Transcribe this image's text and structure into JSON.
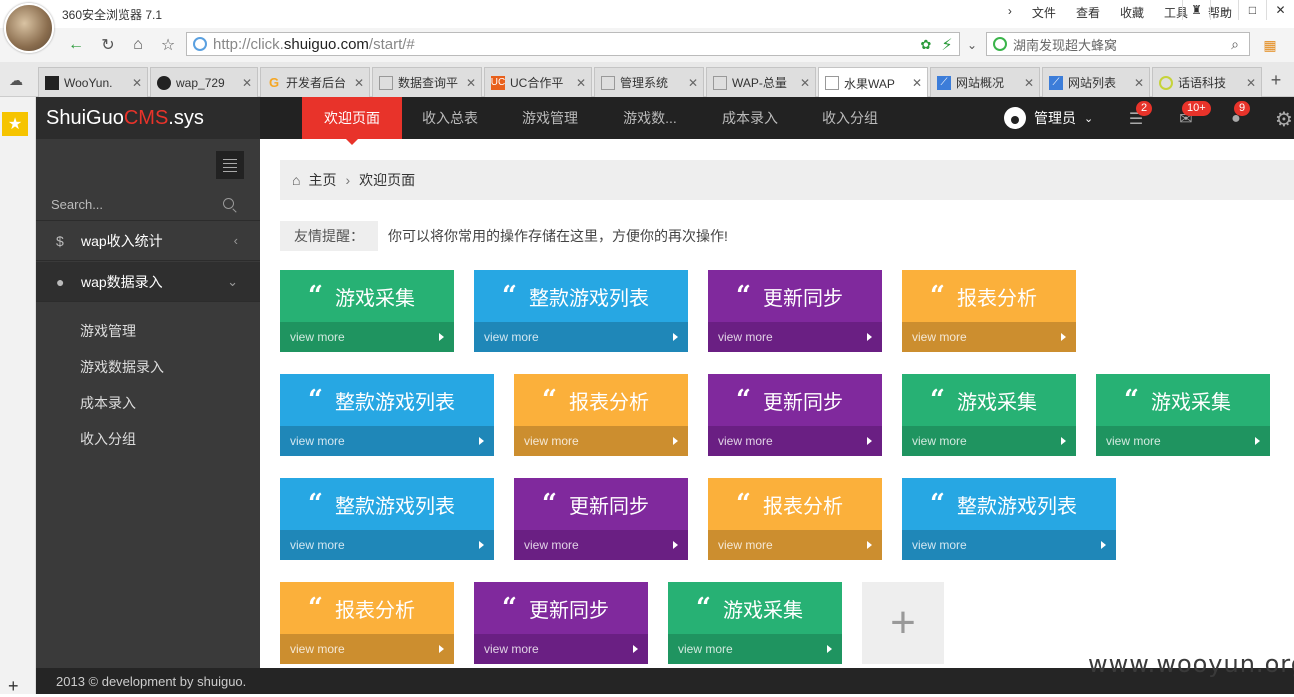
{
  "browser": {
    "title": "360安全浏览器 7.1",
    "menu": [
      "文件",
      "查看",
      "收藏",
      "工具",
      "帮助"
    ],
    "url_prefix": "http://click.",
    "url_domain": "shuiguo.com",
    "url_path": "/start/#",
    "search": "湖南发现超大蜂窝",
    "tabs": [
      {
        "label": "WooYun.",
        "color": "#222"
      },
      {
        "label": "wap_729",
        "color": "#222"
      },
      {
        "label": "开发者后台",
        "color": "#f5a623"
      },
      {
        "label": "数据查询平",
        "color": "#999"
      },
      {
        "label": "UC合作平",
        "color": "#e8601c"
      },
      {
        "label": "管理系统",
        "color": "#999"
      },
      {
        "label": "WAP-总量",
        "color": "#999"
      },
      {
        "label": "水果WAP",
        "color": "#999"
      },
      {
        "label": "网站概况",
        "color": "#3c7dd9"
      },
      {
        "label": "网站列表",
        "color": "#3c7dd9"
      },
      {
        "label": "话语科技",
        "color": "#c6d33a"
      }
    ]
  },
  "brand": {
    "a": "ShuiGuo",
    "b": "CMS",
    ".sys": ".sys",
    "c": ".sys"
  },
  "nav": [
    "欢迎页面",
    "收入总表",
    "游戏管理",
    "游戏数...",
    "成本录入",
    "收入分组"
  ],
  "header": {
    "admin": "管理员",
    "badge1": "2",
    "badge2": "10+",
    "badge3": "9"
  },
  "sidebar": {
    "search": "Search...",
    "m1": "wap收入统计",
    "m2": "wap数据录入",
    "subs": [
      "游戏管理",
      "游戏数据录入",
      "成本录入",
      "收入分组"
    ]
  },
  "breadcrumb": {
    "home": "主页",
    "current": "欢迎页面"
  },
  "tip": {
    "label": "友情提醒：",
    "text": "你可以将你常用的操作存储在这里，方便你的再次操作!"
  },
  "more": "view more",
  "cards": [
    "游戏采集",
    "整款游戏列表",
    "更新同步",
    "报表分析",
    "整款游戏列表",
    "报表分析",
    "更新同步",
    "游戏采集",
    "游戏采集",
    "整款游戏列表",
    "更新同步",
    "报表分析",
    "整款游戏列表",
    "报表分析",
    "更新同步",
    "游戏采集"
  ],
  "colors": {
    "green": "#27b174",
    "blue": "#27a7e3",
    "purple": "#80299d",
    "orange": "#fbb03b",
    "accent": "#e8332a"
  },
  "footer": "2013 © development by shuiguo.",
  "watermark": "www.wooyun.org"
}
